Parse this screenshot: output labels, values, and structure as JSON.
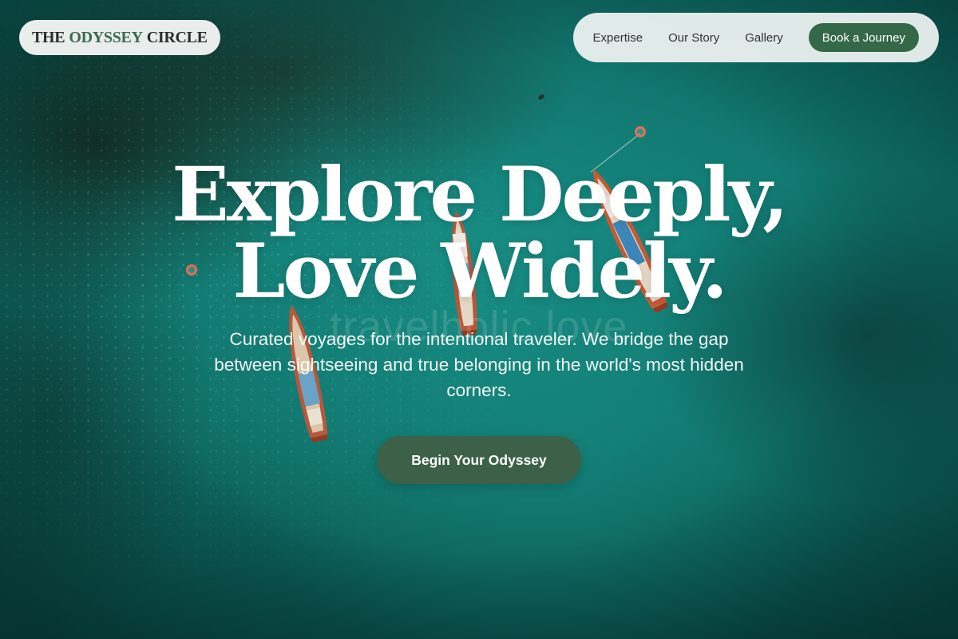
{
  "brand": {
    "logo_prefix": "THE",
    "logo_accent": "ODYSSEY",
    "logo_suffix": "CIRCLE",
    "accent_color": "#3a6b4f"
  },
  "nav": {
    "links": [
      "Expertise",
      "Our Story",
      "Gallery"
    ],
    "cta_label": "Book a Journey",
    "cta_color": "#356848"
  },
  "hero": {
    "title_line1": "Explore Deeply,",
    "title_line2": "Love Widely.",
    "watermark": "travelholic love",
    "subtitle": "Curated voyages for the intentional traveler. We bridge the gap between sightseeing and true belonging in the world's most hidden corners.",
    "cta_label": "Begin Your Odyssey",
    "cta_color": "#3c6048",
    "background": "aerial-teal-water-with-longtail-boats"
  }
}
